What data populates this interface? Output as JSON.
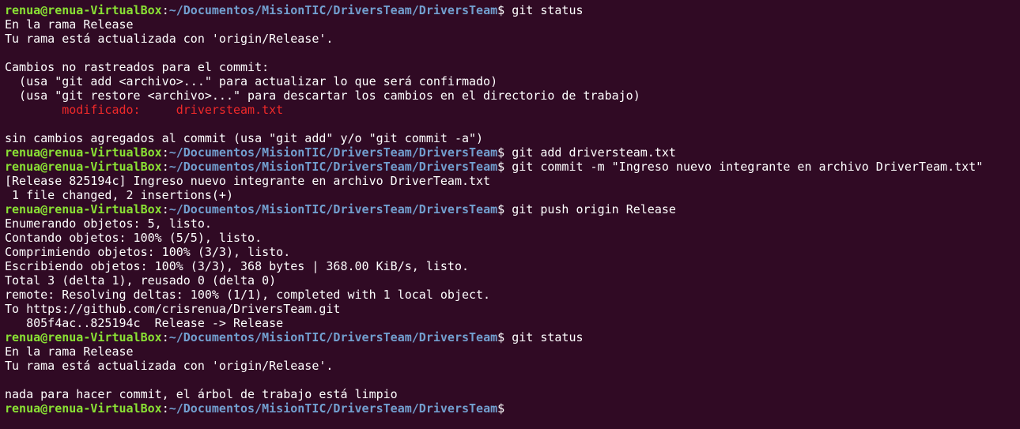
{
  "terminal": {
    "background": "#300a24",
    "prompt_user_color": "#8ae234",
    "prompt_path_color": "#729fcf",
    "modified_color": "#ef2929",
    "prompt": {
      "user": "renua@renua-VirtualBox",
      "colon": ":",
      "path": "~/Documentos/MisionTIC/DriversTeam/DriversTeam",
      "symbol": "$ "
    },
    "lines": [
      {
        "type": "prompt",
        "command": "git status"
      },
      {
        "type": "text",
        "text": "En la rama Release"
      },
      {
        "type": "text",
        "text": "Tu rama está actualizada con 'origin/Release'."
      },
      {
        "type": "text",
        "text": ""
      },
      {
        "type": "text",
        "text": "Cambios no rastreados para el commit:"
      },
      {
        "type": "text",
        "text": "  (usa \"git add <archivo>...\" para actualizar lo que será confirmado)"
      },
      {
        "type": "text",
        "text": "  (usa \"git restore <archivo>...\" para descartar los cambios en el directorio de trabajo)"
      },
      {
        "type": "modified",
        "text": "\tmodificado:     driversteam.txt"
      },
      {
        "type": "text",
        "text": ""
      },
      {
        "type": "text",
        "text": "sin cambios agregados al commit (usa \"git add\" y/o \"git commit -a\")"
      },
      {
        "type": "prompt",
        "command": "git add driversteam.txt"
      },
      {
        "type": "prompt",
        "command": "git commit -m \"Ingreso nuevo integrante en archivo DriverTeam.txt\""
      },
      {
        "type": "text",
        "text": "[Release 825194c] Ingreso nuevo integrante en archivo DriverTeam.txt"
      },
      {
        "type": "text",
        "text": " 1 file changed, 2 insertions(+)"
      },
      {
        "type": "prompt",
        "command": "git push origin Release"
      },
      {
        "type": "text",
        "text": "Enumerando objetos: 5, listo."
      },
      {
        "type": "text",
        "text": "Contando objetos: 100% (5/5), listo."
      },
      {
        "type": "text",
        "text": "Comprimiendo objetos: 100% (3/3), listo."
      },
      {
        "type": "text",
        "text": "Escribiendo objetos: 100% (3/3), 368 bytes | 368.00 KiB/s, listo."
      },
      {
        "type": "text",
        "text": "Total 3 (delta 1), reusado 0 (delta 0)"
      },
      {
        "type": "text",
        "text": "remote: Resolving deltas: 100% (1/1), completed with 1 local object."
      },
      {
        "type": "text",
        "text": "To https://github.com/crisrenua/DriversTeam.git"
      },
      {
        "type": "text",
        "text": "   805f4ac..825194c  Release -> Release"
      },
      {
        "type": "prompt",
        "command": "git status"
      },
      {
        "type": "text",
        "text": "En la rama Release"
      },
      {
        "type": "text",
        "text": "Tu rama está actualizada con 'origin/Release'."
      },
      {
        "type": "text",
        "text": ""
      },
      {
        "type": "text",
        "text": "nada para hacer commit, el árbol de trabajo está limpio"
      },
      {
        "type": "prompt",
        "command": ""
      }
    ]
  }
}
